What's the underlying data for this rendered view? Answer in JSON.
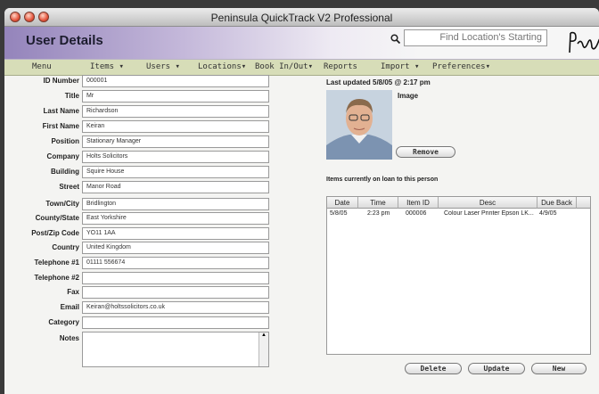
{
  "window": {
    "title": "Peninsula QuickTrack V2 Professional"
  },
  "header": {
    "page_title": "User Details",
    "search_placeholder": "Find Location's Starting",
    "logo_text": "Peninsula"
  },
  "nav": [
    "Menu",
    "Items",
    "Users",
    "Locations",
    "Book In/Out",
    "Reports",
    "Import",
    "Preferences"
  ],
  "form": {
    "labels": [
      "ID Number",
      "Title",
      "Last Name",
      "First Name",
      "Position",
      "Company",
      "Building",
      "Street",
      "Town/City",
      "County/State",
      "Post/Zip Code",
      "Country",
      "Telephone #1",
      "Telephone #2",
      "Fax",
      "Email",
      "Category",
      "Notes"
    ],
    "values": [
      "000001",
      "Mr",
      "Richardson",
      "Keiran",
      "Stationary Manager",
      "Holts Solicitors",
      "Squire House",
      "Manor Road",
      "Bridlington",
      "East Yorkshire",
      "YO11 1AA",
      "United Kingdom",
      "01111 556674",
      "",
      "",
      "Keiran@holtssolicitors.co.uk",
      "",
      ""
    ]
  },
  "record": {
    "last_updated": "Last updated 5/8/05 @ 2:17 pm",
    "image_label": "Image",
    "remove_label": "Remove"
  },
  "loans": {
    "title": "Items currently on loan to this person",
    "columns": [
      "Date",
      "Time",
      "Item ID",
      "Desc",
      "Due Back"
    ],
    "rows": [
      [
        "5/8/05",
        "2:23 pm",
        "000006",
        "Colour Laser Printer Epson LK...",
        "4/9/05"
      ]
    ]
  },
  "actions": {
    "delete": "Delete",
    "update": "Update",
    "new": "New"
  },
  "colors": {
    "nav_bg": "#d7ddb8",
    "header_accent": "#9484bb"
  },
  "icons": {
    "search": "search-icon",
    "close": "close-light",
    "minimize": "minimize-light",
    "zoom": "zoom-light"
  }
}
